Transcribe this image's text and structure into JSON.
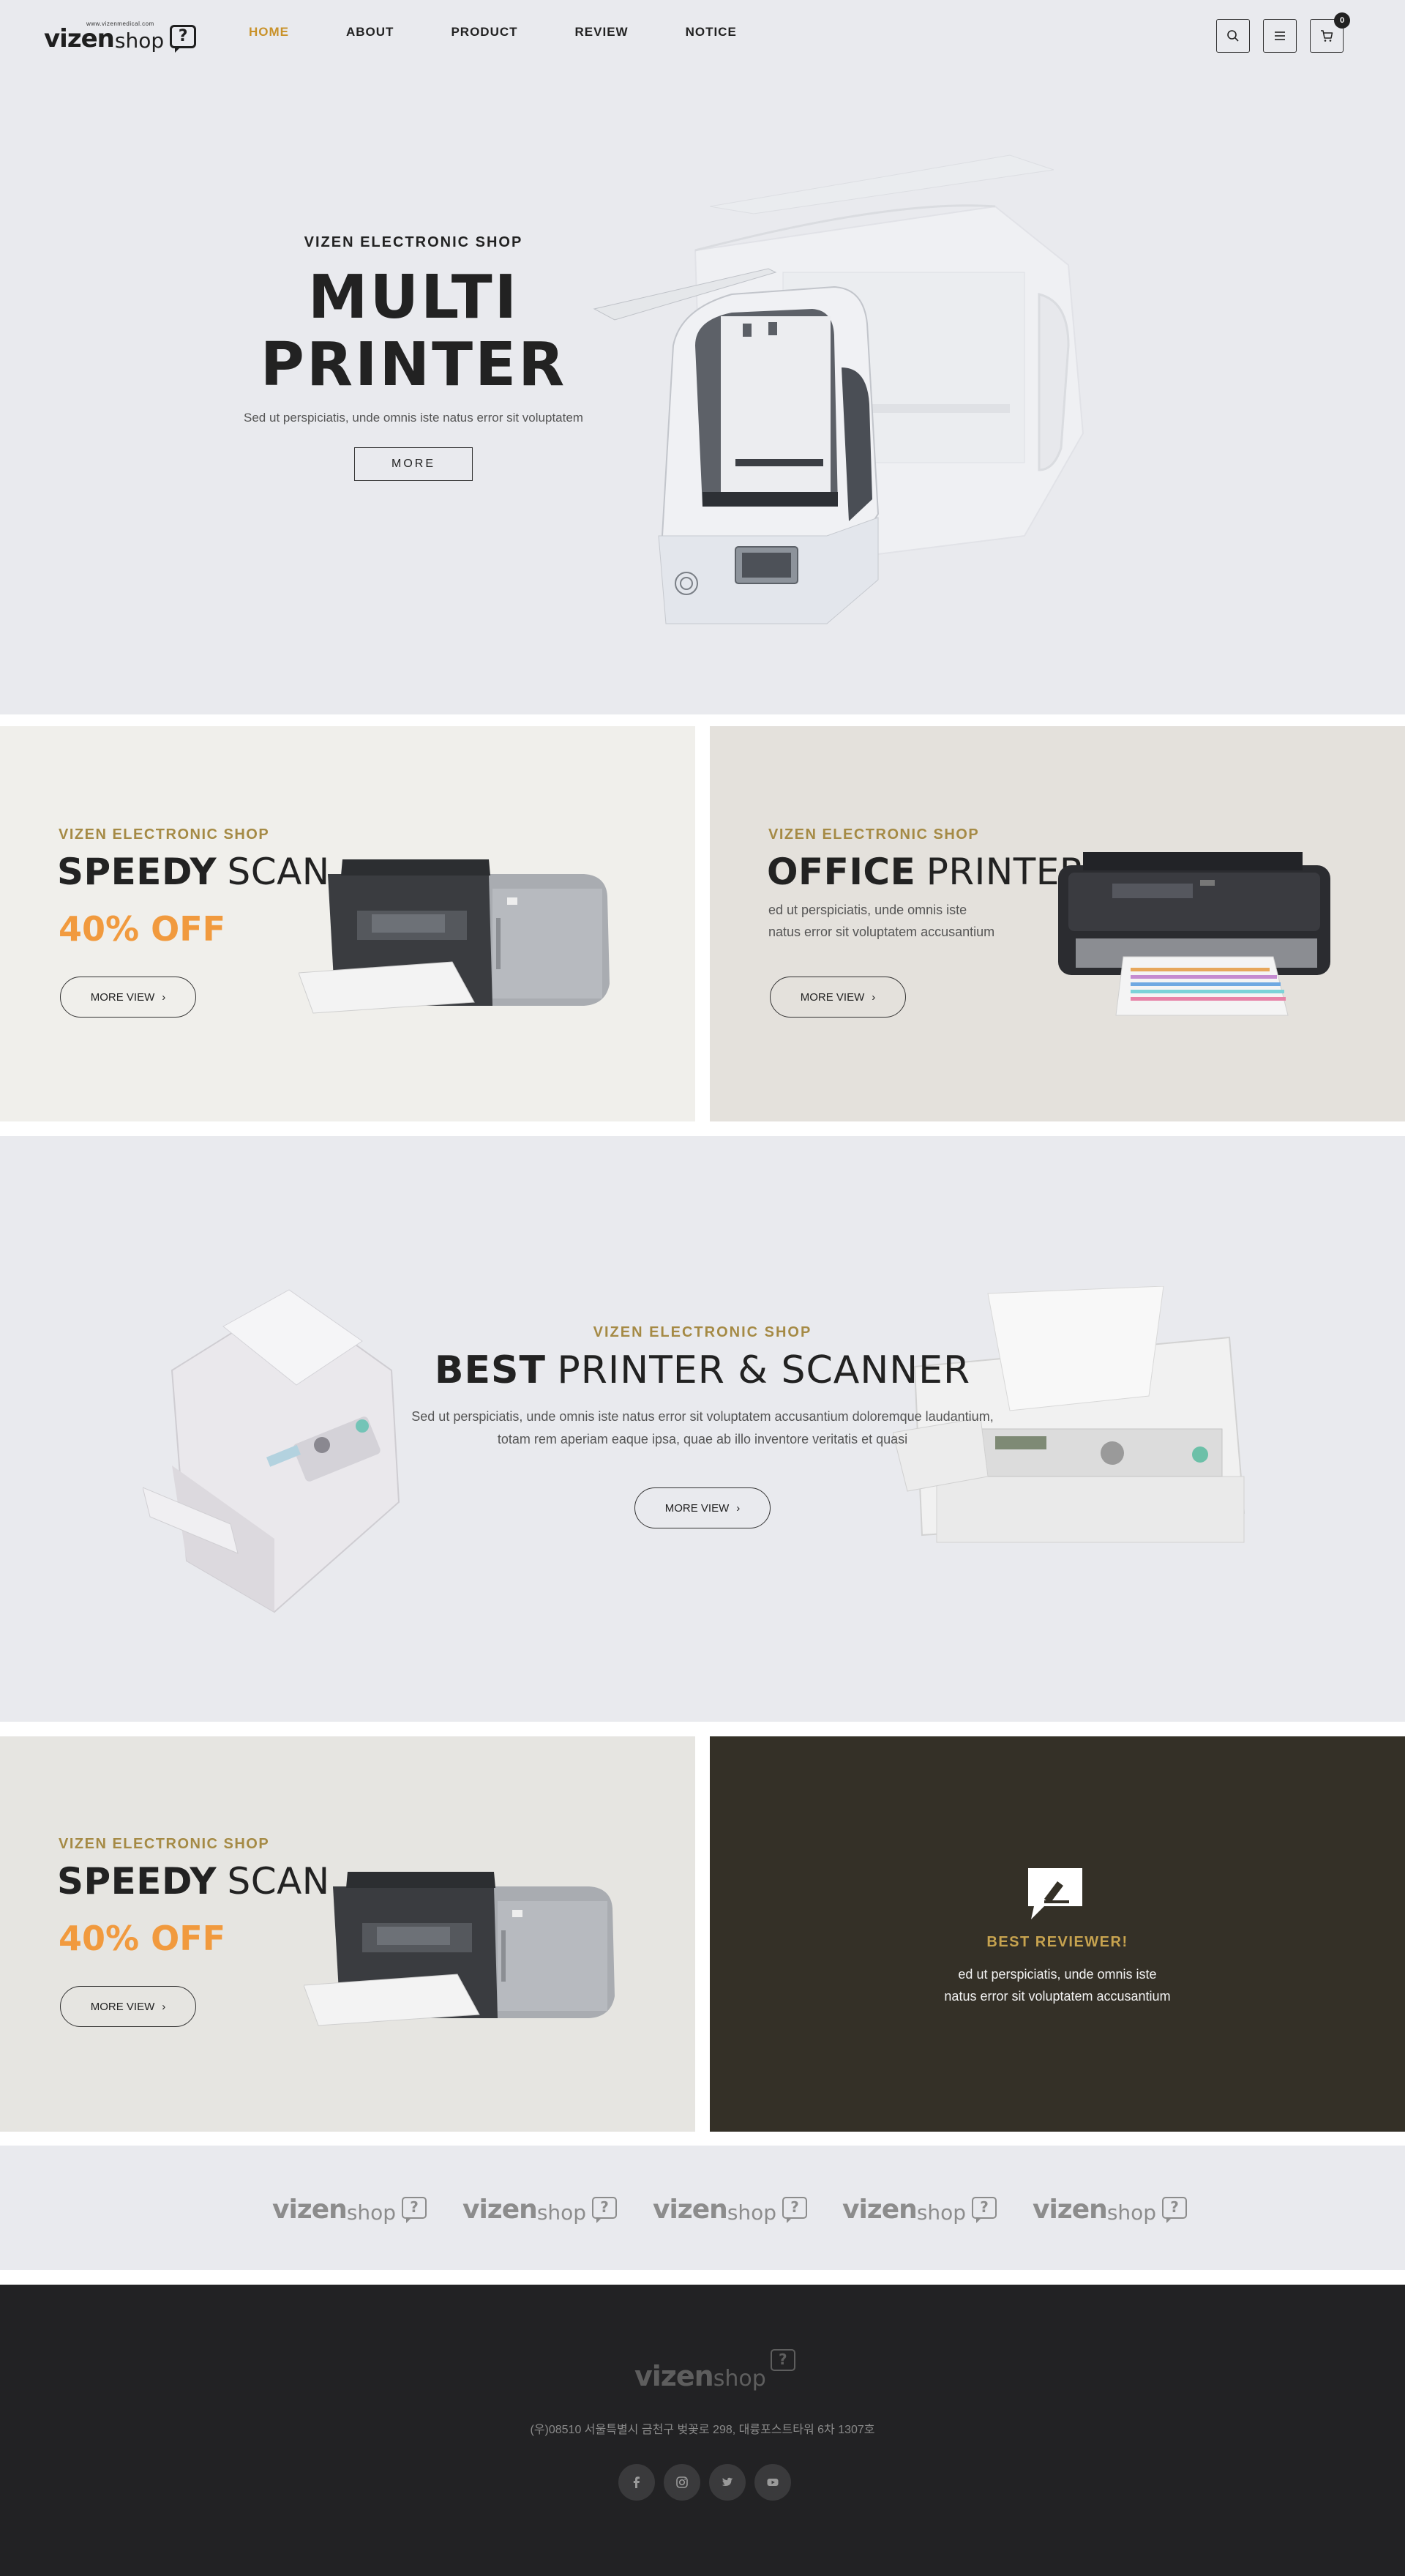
{
  "header": {
    "logo": {
      "wordmark_a": "vizen",
      "wordmark_b": "shop",
      "url": "www.vizenmedical.com",
      "mark": "?"
    },
    "nav": [
      {
        "label": "HOME",
        "active": true
      },
      {
        "label": "ABOUT",
        "active": false
      },
      {
        "label": "PRODUCT",
        "active": false
      },
      {
        "label": "REVIEW",
        "active": false
      },
      {
        "label": "NOTICE",
        "active": false
      }
    ],
    "icons": [
      "search-icon",
      "menu-icon",
      "cart-icon"
    ],
    "cart_count": "0"
  },
  "hero": {
    "kicker": "VIZEN ELECTRONIC SHOP",
    "title_line1": "MULTI",
    "title_line2": "PRINTER",
    "description": "Sed ut perspiciatis, unde omnis iste natus error sit voluptatem",
    "button": "MORE"
  },
  "promo_row1": {
    "left": {
      "kicker": "VIZEN ELECTRONIC SHOP",
      "title_bold": "SPEEDY",
      "title_light": "SCAN",
      "offer": "40% OFF",
      "button": "MORE VIEW",
      "button_icon": "›"
    },
    "right": {
      "kicker": "VIZEN ELECTRONIC SHOP",
      "title_bold": "OFFICE",
      "title_light": "PRINTER",
      "description_line1": "ed ut perspiciatis, unde omnis iste",
      "description_line2": "natus error sit voluptatem accusantium",
      "button": "MORE VIEW",
      "button_icon": "›"
    }
  },
  "feature": {
    "kicker": "VIZEN ELECTRONIC SHOP",
    "title_bold": "BEST",
    "title_light": "PRINTER & SCANNER",
    "description_line1": "Sed ut perspiciatis, unde omnis iste natus error sit voluptatem accusantium doloremque laudantium,",
    "description_line2": "totam rem aperiam eaque ipsa, quae ab illo inventore veritatis et quasi",
    "button": "MORE VIEW",
    "button_icon": "›"
  },
  "promo_row2": {
    "left": {
      "kicker": "VIZEN ELECTRONIC SHOP",
      "title_bold": "SPEEDY",
      "title_light": "SCAN",
      "offer": "40% OFF",
      "button": "MORE VIEW",
      "button_icon": "›"
    },
    "reviewer": {
      "icon": "pen-chat-icon",
      "title": "BEST REVIEWER!",
      "description_line1": "ed ut perspiciatis, unde omnis iste",
      "description_line2": "natus error sit voluptatem accusantium"
    }
  },
  "brands": {
    "logos": [
      {
        "a": "vizen",
        "b": "shop",
        "mark": "?"
      },
      {
        "a": "vizen",
        "b": "shop",
        "mark": "?"
      },
      {
        "a": "vizen",
        "b": "shop",
        "mark": "?"
      },
      {
        "a": "vizen",
        "b": "shop",
        "mark": "?"
      },
      {
        "a": "vizen",
        "b": "shop",
        "mark": "?"
      }
    ]
  },
  "footer": {
    "logo": {
      "a": "vizen",
      "b": "shop",
      "mark": "?"
    },
    "address": "(우)08510 서울특별시 금천구 벚꽃로 298, 대륭포스트타워 6차 1307호",
    "social": [
      "facebook-icon",
      "instagram-icon",
      "twitter-icon",
      "youtube-icon"
    ]
  },
  "colors": {
    "accent": "#c9922a",
    "kicker": "#a58a45",
    "offer": "#f19a3e",
    "reviewer_bg": "#343027",
    "footer_bg": "#222224",
    "page_bg": "#e9eaee"
  }
}
